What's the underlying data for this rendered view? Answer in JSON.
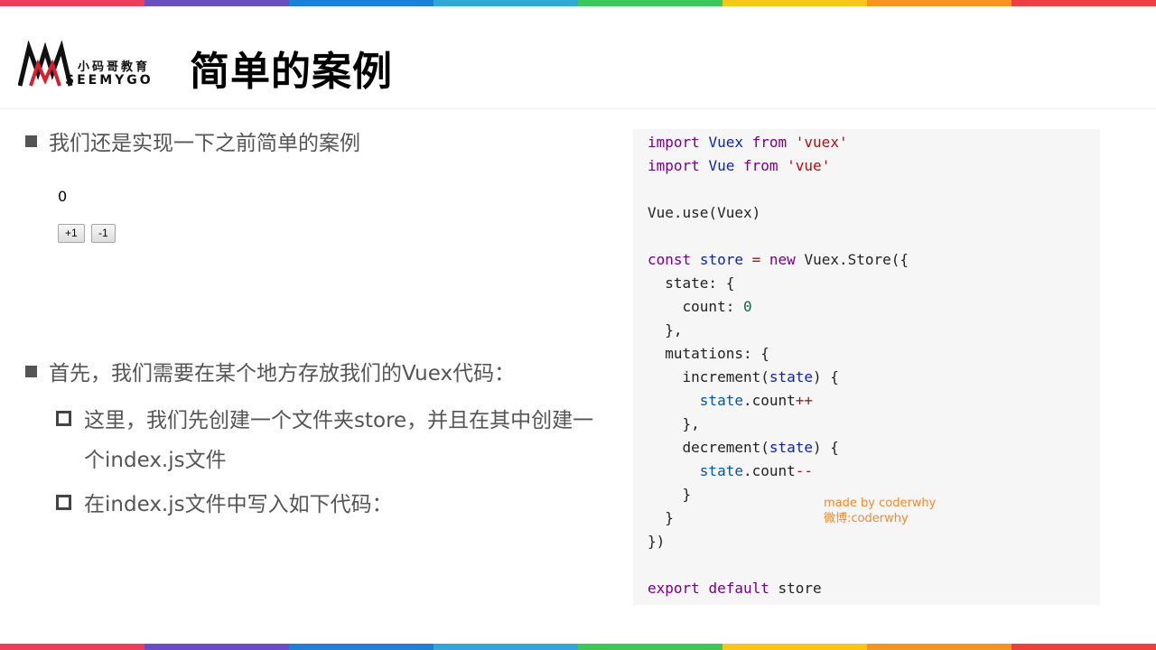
{
  "brand": {
    "name_cn": "小码哥教育",
    "name_en": "SEEMYGO"
  },
  "title": "简单的案例",
  "bullets": [
    "我们还是实现一下之前简单的案例",
    "首先，我们需要在某个地方存放我们的Vuex代码：",
    "这里，我们先创建一个文件夹store，并且在其中创建一",
    "个index.js文件",
    "在index.js文件中写入如下代码："
  ],
  "demo": {
    "count": "0",
    "inc_label": "+1",
    "dec_label": "-1"
  },
  "code": {
    "line1": {
      "kw1": "import",
      "id": "Vuex",
      "kw2": "from",
      "str": "'vuex'"
    },
    "line2": {
      "kw1": "import",
      "id": "Vue",
      "kw2": "from",
      "str": "'vue'"
    },
    "line4": "Vue.use(Vuex)",
    "line6": {
      "kw1": "const",
      "id": "store",
      "op": "=",
      "kw2": "new",
      "rest": "Vuex.Store({"
    },
    "line7": "  state: {",
    "line8": {
      "prop": "    count: ",
      "num": "0"
    },
    "line9": "  },",
    "line10": "  mutations: {",
    "line11": {
      "name": "    increment(",
      "param": "state",
      "rest": ") {"
    },
    "line12": {
      "obj": "      state",
      "prop": ".count",
      "op": "++"
    },
    "line13": "    },",
    "line14": {
      "name": "    decrement(",
      "param": "state",
      "rest": ") {"
    },
    "line15": {
      "obj": "      state",
      "prop": ".count",
      "op": "--"
    },
    "line16": "    }",
    "line17": "  }",
    "line18": "})",
    "line20": {
      "kw1": "export",
      "kw2": "default",
      "id": "store"
    }
  },
  "watermark": {
    "line1": "made by coderwhy",
    "line2": "微博:coderwhy"
  },
  "colors": {
    "stripe": [
      "#ef3e5a",
      "#6a4fc4",
      "#1e7fd8",
      "#2fa8d8",
      "#3cc75a",
      "#f8c61a",
      "#f7931e",
      "#ef3e3e"
    ]
  }
}
